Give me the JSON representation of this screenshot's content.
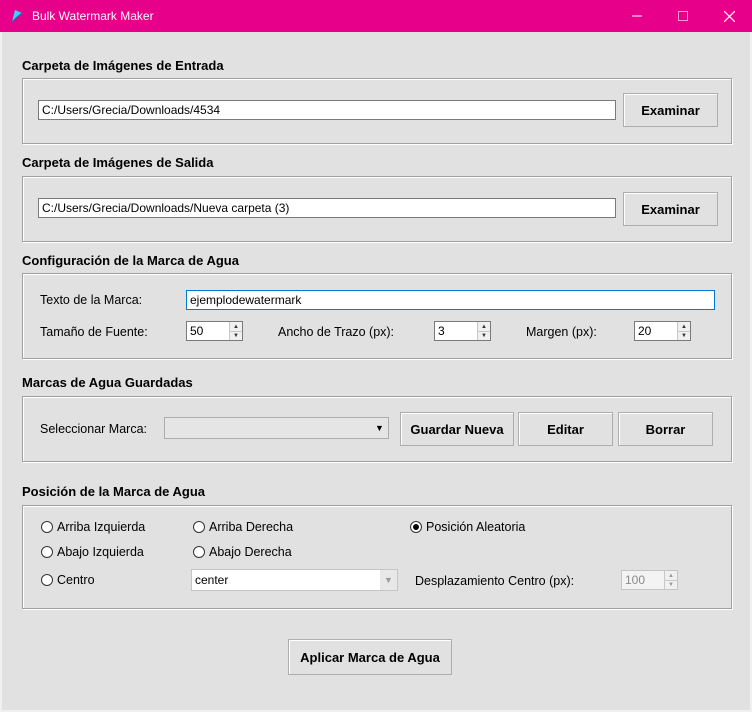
{
  "window": {
    "title": "Bulk Watermark Maker"
  },
  "input": {
    "title": "Carpeta de Imágenes de Entrada",
    "path": "C:/Users/Grecia/Downloads/4534",
    "browse": "Examinar"
  },
  "output": {
    "title": "Carpeta de Imágenes de Salida",
    "path": "C:/Users/Grecia/Downloads/Nueva carpeta (3)",
    "browse": "Examinar"
  },
  "config": {
    "title": "Configuración de la Marca de Agua",
    "text_label": "Texto de la Marca:",
    "text_value": "ejemplodewatermark",
    "font_label": "Tamaño de Fuente:",
    "font_value": "50",
    "stroke_label": "Ancho de Trazo (px):",
    "stroke_value": "3",
    "margin_label": "Margen (px):",
    "margin_value": "20"
  },
  "saved": {
    "title": "Marcas de Agua Guardadas",
    "select_label": "Seleccionar Marca:",
    "select_value": "",
    "save_new": "Guardar Nueva",
    "edit": "Editar",
    "delete": "Borrar"
  },
  "position": {
    "title": "Posición de la Marca de Agua",
    "top_left": "Arriba Izquierda",
    "top_right": "Arriba Derecha",
    "random": "Posición Aleatoria",
    "bottom_left": "Abajo Izquierda",
    "bottom_right": "Abajo Derecha",
    "center": "Centro",
    "center_select": "center",
    "offset_label": "Desplazamiento Centro (px):",
    "offset_value": "100",
    "selected": "random"
  },
  "apply": "Aplicar Marca de Agua",
  "colors": {
    "titlebar": "#e6008a",
    "background": "#e1e1e1"
  }
}
